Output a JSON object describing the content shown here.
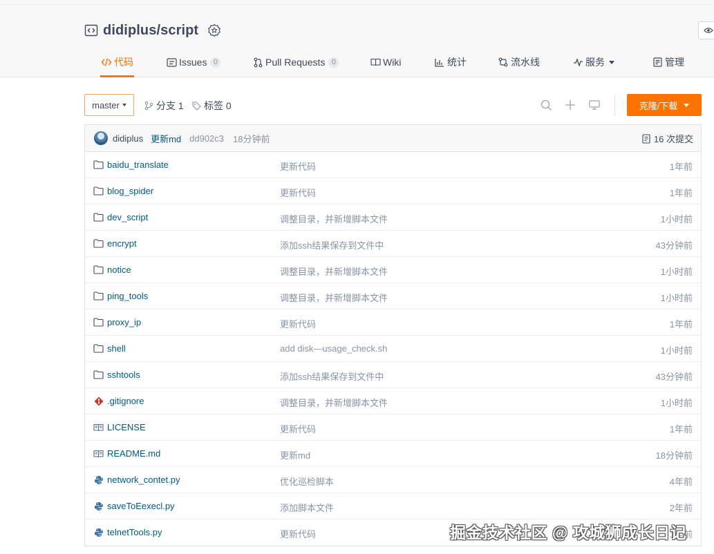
{
  "repo": {
    "name": "didiplus/script"
  },
  "tabs": [
    {
      "label": "代码",
      "icon": "code-icon",
      "active": true
    },
    {
      "label": "Issues",
      "icon": "issues-icon",
      "count": "0"
    },
    {
      "label": "Pull Requests",
      "icon": "pull-request-icon",
      "count": "0"
    },
    {
      "label": "Wiki",
      "icon": "wiki-icon"
    },
    {
      "label": "统计",
      "icon": "stats-icon"
    },
    {
      "label": "流水线",
      "icon": "pipeline-icon"
    },
    {
      "label": "服务",
      "icon": "service-icon"
    },
    {
      "label": "管理",
      "icon": "manage-icon"
    }
  ],
  "toolbar": {
    "branch": "master",
    "branches_label": "分支 1",
    "tags_label": "标签 0",
    "clone_label": "克隆/下载"
  },
  "last_commit": {
    "author": "didiplus",
    "message": "更新md",
    "sha": "dd902c3",
    "time": "18分钟前",
    "commits_label": "16 次提交"
  },
  "files": [
    {
      "name": "baidu_translate",
      "type": "folder",
      "message": "更新代码",
      "time": "1年前"
    },
    {
      "name": "blog_spider",
      "type": "folder",
      "message": "更新代码",
      "time": "1年前"
    },
    {
      "name": "dev_script",
      "type": "folder",
      "message": "调整目录，并新增脚本文件",
      "time": "1小时前"
    },
    {
      "name": "encrypt",
      "type": "folder",
      "message": "添加ssh结果保存到文件中",
      "time": "43分钟前"
    },
    {
      "name": "notice",
      "type": "folder",
      "message": "调整目录，并新增脚本文件",
      "time": "1小时前"
    },
    {
      "name": "ping_tools",
      "type": "folder",
      "message": "调整目录，并新增脚本文件",
      "time": "1小时前"
    },
    {
      "name": "proxy_ip",
      "type": "folder",
      "message": "更新代码",
      "time": "1年前"
    },
    {
      "name": "shell",
      "type": "folder",
      "message": "add disk—usage_check.sh",
      "time": "1小时前"
    },
    {
      "name": "sshtools",
      "type": "folder",
      "message": "添加ssh结果保存到文件中",
      "time": "43分钟前"
    },
    {
      "name": ".gitignore",
      "type": "git",
      "message": "调整目录，并新增脚本文件",
      "time": "1小时前"
    },
    {
      "name": "LICENSE",
      "type": "doc",
      "message": "更新代码",
      "time": "1年前"
    },
    {
      "name": "README.md",
      "type": "doc",
      "message": "更新md",
      "time": "18分钟前"
    },
    {
      "name": "network_contet.py",
      "type": "python",
      "message": "优化巡检脚本",
      "time": "4年前"
    },
    {
      "name": "saveToEexecl.py",
      "type": "python",
      "message": "添加脚本文件",
      "time": "2年前"
    },
    {
      "name": "telnetTools.py",
      "type": "python",
      "message": "更新代码",
      "time": "1年前"
    }
  ],
  "watermark": "掘金技术社区 @ 攻城狮成长日记",
  "colors": {
    "accent": "#fe7300",
    "link": "#005980",
    "muted": "#8c92a4",
    "text": "#40485b"
  }
}
